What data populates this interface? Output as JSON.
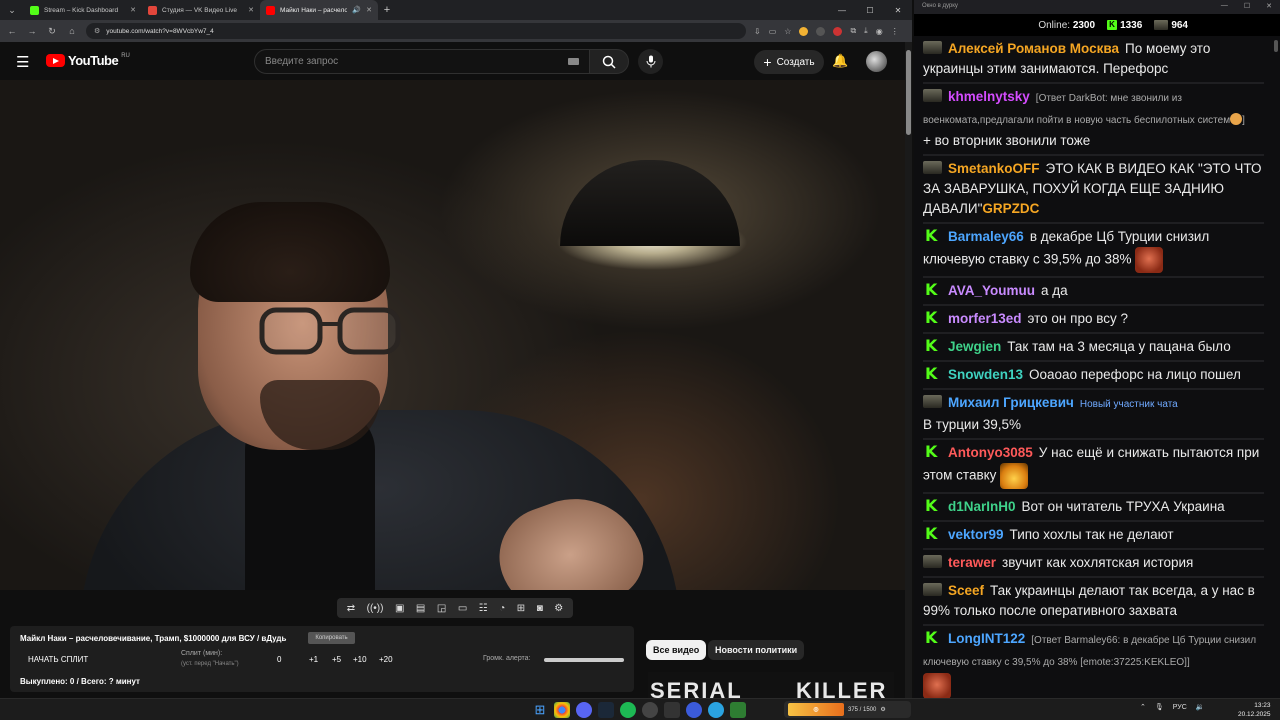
{
  "browser": {
    "tabs": [
      {
        "title": "Stream – Kick Dashboard",
        "color": "#53fc18"
      },
      {
        "title": "Студия — VK Видео Live",
        "color": "#e2463b"
      },
      {
        "title": "Майкл Наки – расчелове...",
        "color": "#ff0000"
      }
    ],
    "url": "youtube.com/watch?v=8WVcbYw7_4"
  },
  "youtube": {
    "logo_text": "YouTube",
    "country": "RU",
    "search_placeholder": "Введите запрос",
    "create_label": "Создать",
    "create_plus": "+"
  },
  "extension_panel": {
    "title": "Майкл Наки – расчеловечивание, Трамп, $1000000 для ВСУ / вДудь",
    "copy_label": "Копировать",
    "start_split_label": "НАЧАТЬ СПЛИТ",
    "split_label": "Сплит (мин):",
    "split_hint": "(уст. перед \"Начать\")",
    "split_values": [
      "0",
      "+1",
      "+5",
      "+10",
      "+20"
    ],
    "alert_label": "Громк. алерта:",
    "alert_volume": 1.0,
    "paid_out": "Выкуплено: 0 / Всего: ? минут"
  },
  "chips": {
    "all": "Все видео",
    "politics": "Новости политики"
  },
  "thumbnail_text": [
    "SERIAL",
    "KILLER"
  ],
  "chat": {
    "window_title": "Окно в дурку",
    "online_label": "Online:",
    "online_count": "2300",
    "kick_count": "1336",
    "other_count": "964",
    "messages": [
      {
        "badge": "t",
        "user": "Алексей Романов Москва",
        "color": "#f5a623",
        "text": "По моему это украинцы этим занимаются. Перефорс"
      },
      {
        "badge": "t",
        "user": "khmelnytsky",
        "color": "#d44cff",
        "reply": "[Ответ DarkBot: мне звонили из военкомата,предлагали пойти в новую часть беспилотных систем",
        "reply_end": "]",
        "text": "+ во вторник звонили тоже"
      },
      {
        "badge": "t",
        "user": "SmetankoOFF",
        "color": "#f5a623",
        "text": "ЭТО КАК В ВИДЕО КАК \"ЭТО ЧТО ЗА ЗАВАРУШКА, ПОХУЙ КОГДА ЕЩЕ ЗАДНИЮ ДАВАЛИ\"",
        "highlight": "GRPZDC"
      },
      {
        "badge": "k",
        "user": "Barmaley66",
        "color": "#4da6ff",
        "text": "в декабре Цб Турции снизил ключевую ставку с 39,5% до 38%"
      },
      {
        "badge": "k",
        "user": "AVA_Youmuu",
        "color": "#c98bff",
        "text": "а да"
      },
      {
        "badge": "k",
        "user": "morfer13ed",
        "color": "#c98bff",
        "text": "это он про всу ?"
      },
      {
        "badge": "k",
        "user": "Jewgien",
        "color": "#3fd28a",
        "text": "Так там на 3 месяца у пацана было"
      },
      {
        "badge": "k",
        "user": "Snowden13",
        "color": "#3fd2c0",
        "text": "Ооаоао перефорс на лицо пошел"
      },
      {
        "badge": "t",
        "user": "Михаил Грицкевич",
        "color": "#4da6ff",
        "newbie": "Новый участник чата",
        "text": "В турции 39,5%"
      },
      {
        "badge": "k",
        "user": "Antonyo3085",
        "color": "#ff5a5a",
        "text": "У нас ещё и снижать пытаются при этом ставку"
      },
      {
        "badge": "k",
        "user": "d1NarInH0",
        "color": "#3fd28a",
        "text": "Вот он читатель ТРУХА Украина"
      },
      {
        "badge": "k",
        "user": "vektor99",
        "color": "#4da6ff",
        "text": "Типо хохлы так не делают"
      },
      {
        "badge": "t",
        "user": "terawer",
        "color": "#ff5a5a",
        "text": "звучит как хохлятская история"
      },
      {
        "badge": "t",
        "user": "Sceef",
        "color": "#f5a623",
        "text": "Так украинцы делают так всегда, а у нас в 99% только после оперативного захвата"
      },
      {
        "badge": "k",
        "user": "LongINT122",
        "color": "#4da6ff",
        "reply": "[Ответ Barmaley66: в декабре Цб Турции снизил ключевую ставку с 39,5% до 38% [emote:37225:KEKLEO]]",
        "text": ""
      }
    ]
  },
  "taskbar": {
    "media_text": "375 / 1500",
    "lang": "РУС",
    "time": "13:23",
    "date": "20.12.2025"
  }
}
